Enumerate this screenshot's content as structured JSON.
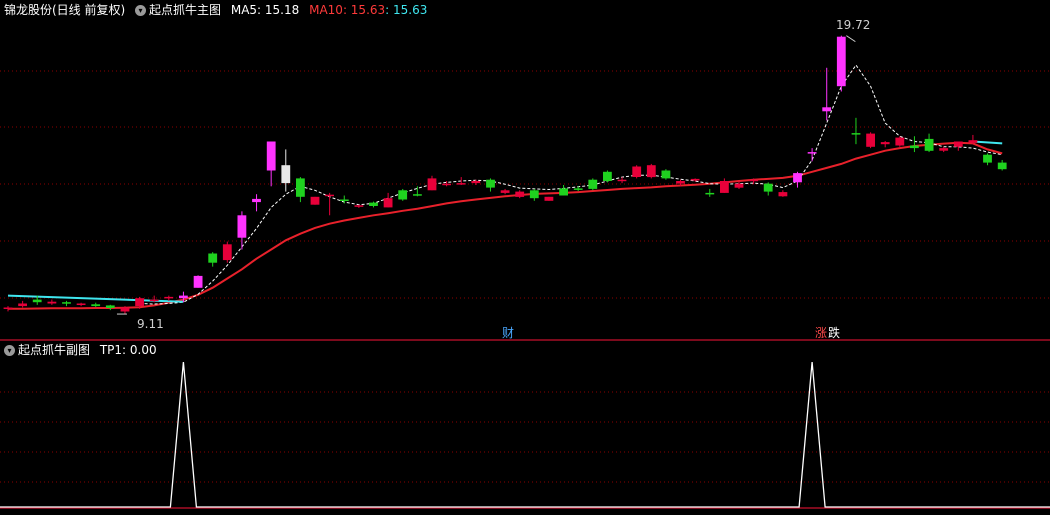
{
  "header": {
    "stock_name": "锦龙股份(日线 前复权)",
    "indicator_name": "起点抓牛主图",
    "ma5_label": "MA5: 15.18",
    "ma10_label": "MA10: 15.63",
    "ma_extra_label": ": 15.63",
    "menu_icon": "chevron-down-icon"
  },
  "sub_header": {
    "indicator_name": "起点抓牛副图",
    "tp1_label": "TP1: 0.00",
    "menu_icon": "chevron-down-icon"
  },
  "annotations": {
    "high_label": "19.72",
    "low_label": "9.11",
    "event_cai": "财",
    "event_zhang": "涨",
    "event_die": "跌"
  },
  "colors": {
    "bg": "#000000",
    "up": "#e8003a",
    "down": "#1fd21f",
    "signal": "#ff33ff",
    "white_candle": "#e8e8e8",
    "ma_slow": "#e8212b",
    "ma_cyan": "#3fe6ef",
    "ma_dash": "#ffffff",
    "grid": "#8b0000",
    "separator": "#c8102e",
    "header_white": "#ffffff",
    "header_red": "#ff3a3a",
    "header_cyan": "#3fe6ef",
    "event_cai": "#4aa8ff",
    "event_zhang": "#ff4a4a",
    "event_die": "#ffffff"
  },
  "chart_data": [
    {
      "type": "candlestick",
      "title": "起点抓牛主图",
      "x": [
        1,
        2,
        3,
        4,
        5,
        6,
        7,
        8,
        9,
        10,
        11,
        12,
        13,
        14,
        15,
        16,
        17,
        18,
        19,
        20,
        21,
        22,
        23,
        24,
        25,
        26,
        27,
        28,
        29,
        30,
        31,
        32,
        33,
        34,
        35,
        36,
        37,
        38,
        39,
        40,
        41,
        42,
        43,
        44,
        45,
        46,
        47,
        48,
        49,
        50,
        51,
        52,
        53,
        54,
        55,
        56,
        57,
        58,
        59,
        60,
        61,
        62,
        63,
        64,
        65,
        66,
        67,
        68,
        69
      ],
      "ohlc": [
        [
          9.35,
          9.45,
          9.25,
          9.4,
          "up"
        ],
        [
          9.55,
          9.65,
          9.4,
          9.45,
          "up"
        ],
        [
          9.6,
          9.85,
          9.5,
          9.7,
          "down"
        ],
        [
          9.62,
          9.7,
          9.5,
          9.55,
          "up"
        ],
        [
          9.55,
          9.65,
          9.45,
          9.6,
          "down"
        ],
        [
          9.5,
          9.58,
          9.45,
          9.55,
          "up"
        ],
        [
          9.52,
          9.58,
          9.42,
          9.45,
          "down"
        ],
        [
          9.48,
          9.5,
          9.3,
          9.38,
          "down"
        ],
        [
          9.4,
          9.45,
          9.15,
          9.25,
          "up"
        ],
        [
          9.45,
          9.8,
          9.35,
          9.75,
          "up"
        ],
        [
          9.7,
          9.85,
          9.6,
          9.68,
          "up"
        ],
        [
          9.78,
          9.85,
          9.65,
          9.8,
          "up"
        ],
        [
          9.75,
          10.0,
          9.6,
          9.85,
          "signal"
        ],
        [
          10.15,
          10.62,
          10.15,
          10.6,
          "signal"
        ],
        [
          11.1,
          11.5,
          10.95,
          11.45,
          "down"
        ],
        [
          11.2,
          11.9,
          11.1,
          11.8,
          "up"
        ],
        [
          12.05,
          13.05,
          11.6,
          12.9,
          "signal"
        ],
        [
          13.52,
          13.7,
          13.05,
          13.4,
          "signal"
        ],
        [
          14.6,
          15.7,
          14.0,
          15.7,
          "signal"
        ],
        [
          14.12,
          15.4,
          13.8,
          14.8,
          "white"
        ],
        [
          13.6,
          14.35,
          13.4,
          14.3,
          "down"
        ],
        [
          13.3,
          13.6,
          13.3,
          13.6,
          "up"
        ],
        [
          13.65,
          13.75,
          12.9,
          13.68,
          "up"
        ],
        [
          13.45,
          13.65,
          13.35,
          13.5,
          "down"
        ],
        [
          13.25,
          13.3,
          13.18,
          13.28,
          "up"
        ],
        [
          13.38,
          13.42,
          13.2,
          13.25,
          "down"
        ],
        [
          13.2,
          13.75,
          13.2,
          13.55,
          "up"
        ],
        [
          13.5,
          13.9,
          13.45,
          13.85,
          "down"
        ],
        [
          13.65,
          14.0,
          13.62,
          13.7,
          "down"
        ],
        [
          13.85,
          14.4,
          13.85,
          14.3,
          "up"
        ],
        [
          14.1,
          14.2,
          14.0,
          14.1,
          "up"
        ],
        [
          14.12,
          14.35,
          14.05,
          14.12,
          "up"
        ],
        [
          14.12,
          14.25,
          14.05,
          14.2,
          "up"
        ],
        [
          14.25,
          14.3,
          13.8,
          13.95,
          "down"
        ],
        [
          13.85,
          13.9,
          13.7,
          13.75,
          "up"
        ],
        [
          13.8,
          13.85,
          13.55,
          13.6,
          "up"
        ],
        [
          13.85,
          13.9,
          13.45,
          13.55,
          "down"
        ],
        [
          13.45,
          13.6,
          13.45,
          13.6,
          "up"
        ],
        [
          13.65,
          14.05,
          13.65,
          13.92,
          "down"
        ],
        [
          13.92,
          14.0,
          13.82,
          13.9,
          "down"
        ],
        [
          13.9,
          14.3,
          13.85,
          14.25,
          "down"
        ],
        [
          14.2,
          14.6,
          14.15,
          14.55,
          "down"
        ],
        [
          14.25,
          14.35,
          14.12,
          14.2,
          "up"
        ],
        [
          14.35,
          14.8,
          14.3,
          14.75,
          "up"
        ],
        [
          14.8,
          14.85,
          14.3,
          14.35,
          "up"
        ],
        [
          14.6,
          14.65,
          14.25,
          14.3,
          "down"
        ],
        [
          14.1,
          14.25,
          14.0,
          14.2,
          "up"
        ],
        [
          14.28,
          14.3,
          14.18,
          14.22,
          "up"
        ],
        [
          13.75,
          13.9,
          13.6,
          13.75,
          "down"
        ],
        [
          13.75,
          14.3,
          13.75,
          14.2,
          "up"
        ],
        [
          13.95,
          14.2,
          13.9,
          14.1,
          "up"
        ],
        [
          14.25,
          14.3,
          14.08,
          14.2,
          "up"
        ],
        [
          14.1,
          14.15,
          13.65,
          13.8,
          "down"
        ],
        [
          13.78,
          13.85,
          13.6,
          13.62,
          "up"
        ],
        [
          14.15,
          14.55,
          13.95,
          14.5,
          "signal"
        ],
        [
          15.25,
          15.45,
          14.95,
          15.3,
          "signal"
        ],
        [
          16.85,
          18.5,
          16.5,
          17.0,
          "signal"
        ],
        [
          17.8,
          19.72,
          17.6,
          19.68,
          "signal"
        ],
        [
          16.0,
          16.6,
          15.6,
          16.02,
          "down"
        ],
        [
          16.0,
          16.05,
          15.45,
          15.5,
          "up"
        ],
        [
          15.6,
          15.72,
          15.48,
          15.68,
          "up"
        ],
        [
          15.85,
          15.9,
          15.5,
          15.55,
          "up"
        ],
        [
          15.55,
          15.9,
          15.3,
          15.45,
          "down"
        ],
        [
          15.8,
          16.0,
          15.3,
          15.35,
          "down"
        ],
        [
          15.45,
          15.5,
          15.3,
          15.35,
          "up"
        ],
        [
          15.7,
          15.7,
          15.35,
          15.5,
          "up"
        ],
        [
          15.75,
          15.95,
          15.6,
          15.65,
          "up"
        ],
        [
          15.2,
          15.25,
          14.8,
          14.9,
          "down"
        ],
        [
          14.9,
          15.0,
          14.6,
          14.65,
          "down"
        ]
      ],
      "ma_slow": [
        9.35,
        9.35,
        9.36,
        9.37,
        9.37,
        9.37,
        9.38,
        9.38,
        9.39,
        9.41,
        9.48,
        9.58,
        9.7,
        9.88,
        10.15,
        10.5,
        10.85,
        11.25,
        11.6,
        11.95,
        12.2,
        12.42,
        12.58,
        12.7,
        12.8,
        12.9,
        12.98,
        13.07,
        13.15,
        13.25,
        13.35,
        13.43,
        13.5,
        13.56,
        13.62,
        13.67,
        13.71,
        13.73,
        13.75,
        13.78,
        13.82,
        13.86,
        13.9,
        13.93,
        13.96,
        14.0,
        14.03,
        14.06,
        14.1,
        14.15,
        14.2,
        14.25,
        14.28,
        14.32,
        14.4,
        14.55,
        14.7,
        14.85,
        15.05,
        15.2,
        15.35,
        15.45,
        15.53,
        15.58,
        15.62,
        15.65,
        15.63,
        15.4,
        15.25
      ],
      "ma_cyan_points": [
        [
          1,
          9.85
        ],
        [
          13,
          9.62
        ]
      ],
      "ma_cyan_tail_points": [
        [
          67,
          15.7
        ],
        [
          69,
          15.63
        ]
      ],
      "ma_dash": [
        null,
        null,
        null,
        null,
        null,
        null,
        null,
        null,
        null,
        9.55,
        9.53,
        9.55,
        9.6,
        9.9,
        10.4,
        11.0,
        11.7,
        12.4,
        13.2,
        13.7,
        14.0,
        13.85,
        13.6,
        13.4,
        13.3,
        13.35,
        13.55,
        13.75,
        13.92,
        14.08,
        14.15,
        14.2,
        14.23,
        14.2,
        14.08,
        13.93,
        13.9,
        13.88,
        13.92,
        13.98,
        14.05,
        14.2,
        14.35,
        14.42,
        14.42,
        14.35,
        14.27,
        14.2,
        14.1,
        14.08,
        14.1,
        14.12,
        14.08,
        13.95,
        14.2,
        15.0,
        16.4,
        17.8,
        18.6,
        17.8,
        16.4,
        15.9,
        15.7,
        15.65,
        15.5,
        15.5,
        15.45,
        15.3,
        15.2
      ],
      "high_label_value": "19.72",
      "low_label_value": "9.11",
      "ylim": [
        9.0,
        20.2
      ]
    },
    {
      "type": "line",
      "title": "起点抓牛副图",
      "series": [
        {
          "name": "TP1",
          "spikes_at_index": [
            12,
            55
          ],
          "peak": 1,
          "base": 0
        }
      ],
      "ylim": [
        0,
        1
      ]
    }
  ]
}
